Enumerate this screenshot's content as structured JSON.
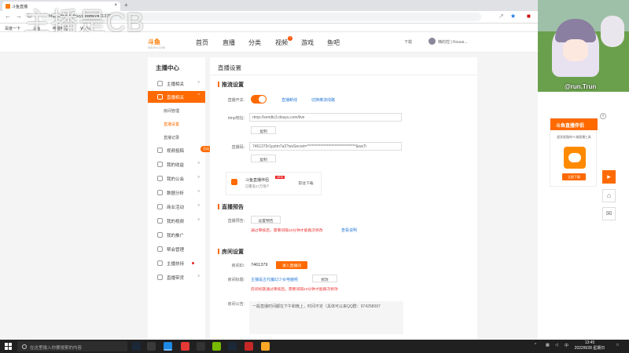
{
  "browser": {
    "tab_title": "斗鱼直播",
    "url": "https://www.douyu.com/7461379",
    "bookmarks": [
      "百度一下",
      "斗鱼",
      "哔哩哔哩",
      "Wi-Fi"
    ]
  },
  "watermark": "主播是CB",
  "site": {
    "logo": "斗鱼",
    "logo_sub": "DOUYU.COM",
    "nav": [
      "首页",
      "直播",
      "分类",
      "视频",
      "游戏",
      "鱼吧"
    ],
    "video_badge": "7",
    "download_label": "下载",
    "username": "楠的控 | Kouus..."
  },
  "sidebar": {
    "title": "主播中心",
    "items": [
      {
        "label": "主播相关"
      },
      {
        "label": "直播相关"
      },
      {
        "label": "房间管理"
      },
      {
        "label": "直播设置"
      },
      {
        "label": "直播记录"
      },
      {
        "label": "视频投稿"
      },
      {
        "label": "我的收益"
      },
      {
        "label": "我的公会"
      },
      {
        "label": "数据分析"
      },
      {
        "label": "商业活动"
      },
      {
        "label": "我的视频"
      },
      {
        "label": "我的推广"
      },
      {
        "label": "帮会管理"
      },
      {
        "label": "主播扶持"
      },
      {
        "label": "直播带货"
      }
    ],
    "promo_tag": "活动"
  },
  "main": {
    "page_title": "直播设置",
    "stream_section": "推流设置",
    "stream_switch_label": "直播开关:",
    "live_link": "直播断线",
    "switch_link": "切换推流线路",
    "rtmp_label": "rtmp地址:",
    "rtmp_value": "rtmp://sendtc3.douyu.com/live",
    "copy_label": "复制",
    "code_label": "直播码:",
    "code_value": "7461379r1pztm7a3?wsSecret=********************************&wsTi",
    "promo_title": "斗鱼直播伴侣",
    "promo_sub": "已覆盖17万用户",
    "promo_new": "NEW",
    "promo_btn": "前往下载",
    "preview_section": "直播预告",
    "preview_label": "直播预告:",
    "preview_btn": "设置预告",
    "preview_warn": "通过审核后，需要间隔10分钟才能再次修改",
    "preview_link": "查看说明",
    "room_section": "房间设置",
    "room_id_label": "房间ID:",
    "room_id": "7461379",
    "enter_room_btn": "进入直播间",
    "room_title_label": "房间标题:",
    "room_title": "主播是古代魔幻少女电脑呢",
    "modify_btn": "修改",
    "room_title_warn": "房间标题通过审核后，需要间隔10分钟才能再次修改",
    "notice_label": "房间公告:",
    "notice_text": "一般直播时间都在下午和晚上，时间不定（具体可以来QQ群：974258097"
  },
  "right_ad": {
    "head": "斗鱼直播伴侣",
    "sub": "超多超强的PC端直播工具",
    "img_caption": "DOUYU",
    "btn": "立即下载"
  },
  "webcam": {
    "caption": "@run.Trun"
  },
  "taskbar": {
    "search_placeholder": "在这里输入你要搜索的内容",
    "time": "13:45",
    "date": "2022/8/28 星期日"
  }
}
